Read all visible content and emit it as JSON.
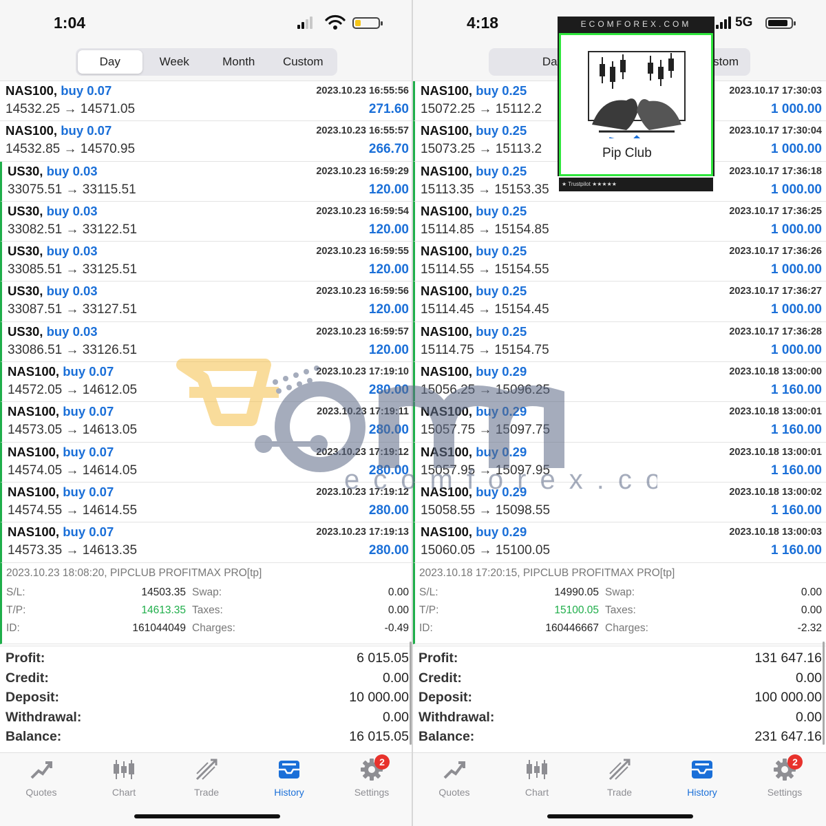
{
  "left": {
    "status": {
      "time": "1:04"
    },
    "segments": [
      "Day",
      "Week",
      "Month",
      "Custom"
    ],
    "active_segment": "Day",
    "trades": [
      {
        "symbol": "NAS100,",
        "side": "buy 0.07",
        "time": "2023.10.23 16:55:56",
        "prices": "14532.25 → 14571.05",
        "profit": "271.60"
      },
      {
        "symbol": "NAS100,",
        "side": "buy 0.07",
        "time": "2023.10.23 16:55:57",
        "prices": "14532.85 → 14570.95",
        "profit": "266.70"
      },
      {
        "symbol": "US30,",
        "side": "buy 0.03",
        "time": "2023.10.23 16:59:29",
        "prices": "33075.51 → 33115.51",
        "profit": "120.00"
      },
      {
        "symbol": "US30,",
        "side": "buy 0.03",
        "time": "2023.10.23 16:59:54",
        "prices": "33082.51 → 33122.51",
        "profit": "120.00"
      },
      {
        "symbol": "US30,",
        "side": "buy 0.03",
        "time": "2023.10.23 16:59:55",
        "prices": "33085.51 → 33125.51",
        "profit": "120.00"
      },
      {
        "symbol": "US30,",
        "side": "buy 0.03",
        "time": "2023.10.23 16:59:56",
        "prices": "33087.51 → 33127.51",
        "profit": "120.00"
      },
      {
        "symbol": "US30,",
        "side": "buy 0.03",
        "time": "2023.10.23 16:59:57",
        "prices": "33086.51 → 33126.51",
        "profit": "120.00"
      },
      {
        "symbol": "NAS100,",
        "side": "buy 0.07",
        "time": "2023.10.23 17:19:10",
        "prices": "14572.05 → 14612.05",
        "profit": "280.00"
      },
      {
        "symbol": "NAS100,",
        "side": "buy 0.07",
        "time": "2023.10.23 17:19:11",
        "prices": "14573.05 → 14613.05",
        "profit": "280.00"
      },
      {
        "symbol": "NAS100,",
        "side": "buy 0.07",
        "time": "2023.10.23 17:19:12",
        "prices": "14574.05 → 14614.05",
        "profit": "280.00"
      },
      {
        "symbol": "NAS100,",
        "side": "buy 0.07",
        "time": "2023.10.23 17:19:12",
        "prices": "14574.55 → 14614.55",
        "profit": "280.00"
      },
      {
        "symbol": "NAS100,",
        "side": "buy 0.07",
        "time": "2023.10.23 17:19:13",
        "prices": "14573.35 → 14613.35",
        "profit": "280.00"
      }
    ],
    "detail": {
      "header": "2023.10.23 18:08:20, PIPCLUB PROFITMAX PRO[tp]",
      "sl_label": "S/L:",
      "sl": "14503.35",
      "tp_label": "T/P:",
      "tp": "14613.35",
      "id_label": "ID:",
      "id": "161044049",
      "swap_label": "Swap:",
      "swap": "0.00",
      "taxes_label": "Taxes:",
      "taxes": "0.00",
      "charges_label": "Charges:",
      "charges": "-0.49"
    },
    "summary": [
      {
        "label": "Profit:",
        "value": "6 015.05"
      },
      {
        "label": "Credit:",
        "value": "0.00"
      },
      {
        "label": "Deposit:",
        "value": "10 000.00"
      },
      {
        "label": "Withdrawal:",
        "value": "0.00"
      },
      {
        "label": "Balance:",
        "value": "16 015.05"
      }
    ],
    "tabs": [
      {
        "label": "Quotes",
        "icon": "quotes-icon"
      },
      {
        "label": "Chart",
        "icon": "chart-icon"
      },
      {
        "label": "Trade",
        "icon": "trade-icon"
      },
      {
        "label": "History",
        "icon": "history-icon"
      },
      {
        "label": "Settings",
        "icon": "settings-icon"
      }
    ],
    "badge": "2"
  },
  "right": {
    "status": {
      "time": "4:18",
      "network": "5G"
    },
    "segments": [
      "Day",
      "stom"
    ],
    "active_segment": "Day",
    "trades": [
      {
        "symbol": "NAS100,",
        "side": "buy 0.25",
        "time": "2023.10.17 17:30:03",
        "prices": "15072.25 → 15112.2",
        "profit": "1 000.00"
      },
      {
        "symbol": "NAS100,",
        "side": "buy 0.25",
        "time": "2023.10.17 17:30:04",
        "prices": "15073.25 → 15113.2",
        "profit": "1 000.00"
      },
      {
        "symbol": "NAS100,",
        "side": "buy 0.25",
        "time": "2023.10.17 17:36:18",
        "prices": "15113.35 → 15153.35",
        "profit": "1 000.00"
      },
      {
        "symbol": "NAS100,",
        "side": "buy 0.25",
        "time": "2023.10.17 17:36:25",
        "prices": "15114.85 → 15154.85",
        "profit": "1 000.00"
      },
      {
        "symbol": "NAS100,",
        "side": "buy 0.25",
        "time": "2023.10.17 17:36:26",
        "prices": "15114.55 → 15154.55",
        "profit": "1 000.00"
      },
      {
        "symbol": "NAS100,",
        "side": "buy 0.25",
        "time": "2023.10.17 17:36:27",
        "prices": "15114.45 → 15154.45",
        "profit": "1 000.00"
      },
      {
        "symbol": "NAS100,",
        "side": "buy 0.25",
        "time": "2023.10.17 17:36:28",
        "prices": "15114.75 → 15154.75",
        "profit": "1 000.00"
      },
      {
        "symbol": "NAS100,",
        "side": "buy 0.29",
        "time": "2023.10.18 13:00:00",
        "prices": "15056.25 → 15096.25",
        "profit": "1 160.00"
      },
      {
        "symbol": "NAS100,",
        "side": "buy 0.29",
        "time": "2023.10.18 13:00:01",
        "prices": "15057.75 → 15097.75",
        "profit": "1 160.00"
      },
      {
        "symbol": "NAS100,",
        "side": "buy 0.29",
        "time": "2023.10.18 13:00:01",
        "prices": "15057.95 → 15097.95",
        "profit": "1 160.00"
      },
      {
        "symbol": "NAS100,",
        "side": "buy 0.29",
        "time": "2023.10.18 13:00:02",
        "prices": "15058.55 → 15098.55",
        "profit": "1 160.00"
      },
      {
        "symbol": "NAS100,",
        "side": "buy 0.29",
        "time": "2023.10.18 13:00:03",
        "prices": "15060.05 → 15100.05",
        "profit": "1 160.00"
      }
    ],
    "detail": {
      "header": "2023.10.18 17:20:15, PIPCLUB PROFITMAX PRO[tp]",
      "sl_label": "S/L:",
      "sl": "14990.05",
      "tp_label": "T/P:",
      "tp": "15100.05",
      "id_label": "ID:",
      "id": "160446667",
      "swap_label": "Swap:",
      "swap": "0.00",
      "taxes_label": "Taxes:",
      "taxes": "0.00",
      "charges_label": "Charges:",
      "charges": "-2.32"
    },
    "summary": [
      {
        "label": "Profit:",
        "value": "131 647.16"
      },
      {
        "label": "Credit:",
        "value": "0.00"
      },
      {
        "label": "Deposit:",
        "value": "100 000.00"
      },
      {
        "label": "Withdrawal:",
        "value": "0.00"
      },
      {
        "label": "Balance:",
        "value": "231 647.16"
      }
    ],
    "tabs": [
      {
        "label": "Quotes",
        "icon": "quotes-icon"
      },
      {
        "label": "Chart",
        "icon": "chart-icon"
      },
      {
        "label": "Trade",
        "icon": "trade-icon"
      },
      {
        "label": "History",
        "icon": "history-icon"
      },
      {
        "label": "Settings",
        "icon": "settings-icon"
      }
    ],
    "badge": "2"
  },
  "active_tab": "History",
  "watermark": {
    "text": "ecomforex.com"
  },
  "ad": {
    "banner": "ECOMFOREX.COM",
    "brand": "Pip Club",
    "trustpilot": "★ Trustpilot ★★★★★"
  },
  "colors": {
    "buy": "#1a6fd8",
    "profit": "#1a6fd8",
    "tp": "#1fae4a",
    "accent_bar": "#1fae4a",
    "badge": "#e8322c",
    "watermark_orange": "#f5c04a",
    "watermark_gray": "#5d6a86"
  }
}
